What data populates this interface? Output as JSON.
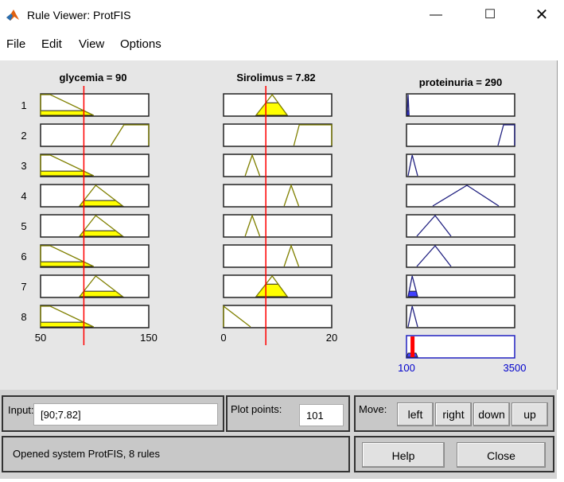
{
  "window": {
    "title": "Rule Viewer: ProtFIS",
    "minimize_icon": "minimize-icon",
    "maximize_icon": "maximize-icon",
    "close_icon": "close-icon"
  },
  "menu": [
    "File",
    "Edit",
    "View",
    "Options"
  ],
  "rule_numbers": [
    "1",
    "2",
    "3",
    "4",
    "5",
    "6",
    "7",
    "8"
  ],
  "variables": [
    {
      "title": "glycemia = 90",
      "range": [
        50,
        150
      ],
      "range_labels": [
        "50",
        "150"
      ],
      "value": 90,
      "type": "input",
      "mfs": [
        [
          50,
          50,
          59,
          99
        ],
        [
          115,
          127,
          150,
          150
        ],
        [
          50,
          50,
          59,
          99
        ],
        [
          86,
          101,
          101,
          126
        ],
        [
          86,
          101,
          101,
          126
        ],
        [
          50,
          50,
          59,
          99
        ],
        [
          86,
          101,
          101,
          126
        ],
        [
          50,
          50,
          59,
          99
        ]
      ]
    },
    {
      "title": "Sirolimus = 7.82",
      "range": [
        0,
        20
      ],
      "range_labels": [
        "0",
        "20"
      ],
      "value": 7.82,
      "type": "input",
      "mfs": [
        [
          6,
          9,
          9,
          11.8
        ],
        [
          13,
          14,
          20,
          20
        ],
        [
          4,
          5.3,
          5.3,
          6.7
        ],
        [
          11.2,
          12.5,
          12.5,
          13.9
        ],
        [
          4,
          5.3,
          5.3,
          6.7
        ],
        [
          11.2,
          12.5,
          12.5,
          13.9
        ],
        [
          6,
          9,
          9,
          11.8
        ],
        [
          0,
          0,
          0,
          5
        ]
      ]
    },
    {
      "title": "proteinuria = 290",
      "range": [
        100,
        3500
      ],
      "range_labels": [
        "100",
        "3500"
      ],
      "value": 290,
      "type": "output",
      "mfs": [
        [
          120,
          150,
          150,
          180
        ],
        [
          2975,
          3150,
          3500,
          3500
        ],
        [
          150,
          280,
          280,
          450
        ],
        [
          925,
          2000,
          2000,
          3000
        ],
        [
          425,
          1000,
          1000,
          1500
        ],
        [
          425,
          1000,
          1000,
          1500
        ],
        [
          150,
          280,
          280,
          450
        ],
        [
          150,
          280,
          280,
          450
        ]
      ]
    }
  ],
  "colors": {
    "input_fill": "#ffff00",
    "input_line": "#808000",
    "output_fill": "#4040ff",
    "output_line": "#202080",
    "value_line": "#ff0000",
    "range_label_output": "#0000cc"
  },
  "controls": {
    "input_label": "Input:",
    "input_value": "[90;7.82]",
    "plot_points_label": "Plot points:",
    "plot_points_value": "101",
    "move_label": "Move:",
    "move_buttons": [
      "left",
      "right",
      "down",
      "up"
    ],
    "status": "Opened system ProtFIS, 8 rules",
    "help": "Help",
    "close": "Close"
  }
}
